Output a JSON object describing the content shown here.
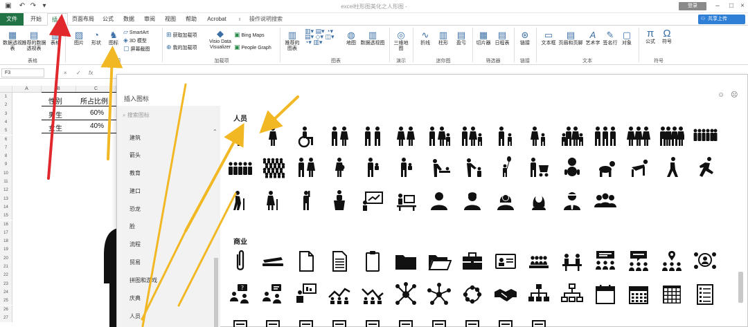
{
  "app": {
    "doc_title": "excel柱形图美化之人形图 -",
    "login_label": "登录",
    "share_label": "共享上传"
  },
  "ribbon": {
    "tabs": [
      {
        "label": "文件",
        "kind": "file"
      },
      {
        "label": "开始",
        "kind": "normal"
      },
      {
        "label": "插入",
        "kind": "active"
      },
      {
        "label": "页面布局",
        "kind": "normal"
      },
      {
        "label": "公式",
        "kind": "normal"
      },
      {
        "label": "数据",
        "kind": "normal"
      },
      {
        "label": "审阅",
        "kind": "normal"
      },
      {
        "label": "视图",
        "kind": "normal"
      },
      {
        "label": "帮助",
        "kind": "normal"
      },
      {
        "label": "Acrobat",
        "kind": "normal"
      },
      {
        "label": "操作说明搜索",
        "kind": "search"
      }
    ],
    "buttons": {
      "pivot": "数据透视表",
      "recommended_pivot": "推荐的数据透视表",
      "table": "表格",
      "picture": "图片",
      "shapes": "形状",
      "icons": "图标",
      "smartart": "SmartArt",
      "model3d": "3D 模型",
      "screenshot": "屏幕截图",
      "get_addins": "获取加载项",
      "my_addins": "我的加载项",
      "visio": "Visio Data Visualizer",
      "bing_maps": "Bing Maps",
      "people_graph": "People Graph",
      "recommended_charts": "推荐的图表",
      "map": "地图",
      "pivot_chart": "数据透视图",
      "map3d": "三维地图",
      "line": "折线",
      "column": "柱形",
      "winloss": "盈亏",
      "slicer": "切片器",
      "timeline": "日程表",
      "link": "链接",
      "textbox": "文本框",
      "header_footer": "页眉和页脚",
      "wordart": "艺术字",
      "signature": "签名行",
      "object": "对象",
      "equation": "公式",
      "symbol": "符号"
    },
    "groups": {
      "tables": "表格",
      "illustrations": "插图",
      "addins": "加载项",
      "charts": "图表",
      "tours": "演示",
      "sparklines": "迷你图",
      "filters": "筛选器",
      "links": "链接",
      "text": "文本",
      "symbols": "符号"
    }
  },
  "formula_bar": {
    "name_box": "F3",
    "fx": "fx"
  },
  "sheet": {
    "columns": [
      "A",
      "B",
      "C"
    ],
    "rows": [
      "1",
      "2",
      "3",
      "4",
      "5",
      "6",
      "7",
      "8",
      "9",
      "10",
      "11",
      "12",
      "13",
      "14",
      "15",
      "16",
      "17",
      "18",
      "19",
      "20",
      "21",
      "22",
      "23",
      "24",
      "25",
      "26",
      "27"
    ],
    "header": {
      "gender": "性别",
      "ratio": "所占比例"
    },
    "data": [
      {
        "gender": "男生",
        "ratio": "60%"
      },
      {
        "gender": "女生",
        "ratio": "40%"
      }
    ]
  },
  "dialog": {
    "title": "插入图标",
    "search_placeholder": "搜索图标",
    "categories": [
      "建筑",
      "箭头",
      "教育",
      "建口",
      "恐龙",
      "脸",
      "流程",
      "贸易",
      "拼图和游戏",
      "庆典",
      "人员"
    ],
    "section_people": "人员",
    "section_business": "商业",
    "people_icons": [
      "man-icon",
      "woman-icon",
      "wheelchair-icon",
      "man-woman-icon",
      "two-men-icon",
      "two-women-icon",
      "couple-child-icon",
      "family-icon",
      "parent-child-icon",
      "woman-child-icon",
      "family-group-icon",
      "three-men-icon",
      "three-women-icon",
      "four-people-icon",
      "crowd-icon",
      "row-people-icon",
      "large-crowd-icon",
      "man-woman-pair-icon",
      "pregnant-icon",
      "carry-child-icon",
      "carry-baby-icon",
      "changing-baby-icon",
      "feeding-child-icon",
      "child-balloon-icon",
      "stroller-icon",
      "baby-icon",
      "crawling-baby-icon",
      "crawling-man-icon",
      "walking-icon",
      "running-icon",
      "elderly-cane-icon",
      "elderly-woman-icon",
      "raised-hand-icon",
      "podium-speaker-icon",
      "presenter-icon",
      "desk-worker-icon",
      "user-avatar-icon",
      "man-avatar-icon",
      "woman-avatar-icon",
      "long-hair-avatar-icon",
      "business-avatar-icon",
      "group-avatar-icon"
    ],
    "business_icons": [
      "paperclip-icon",
      "stapler-icon",
      "document-icon",
      "text-document-icon",
      "clipboard-icon",
      "folder-icon",
      "open-folder-icon",
      "briefcase-icon",
      "id-card-icon",
      "meeting-icon",
      "desk-meeting-icon",
      "presentation-group-icon",
      "speech-group-icon",
      "location-people-icon",
      "network-people-icon",
      "question-people-icon",
      "discussion-icon",
      "presentation-icon",
      "trend-people-icon",
      "downtrend-people-icon",
      "network-node-icon",
      "hub-icon",
      "network-ring-icon",
      "handshake-icon",
      "org-chart-icon",
      "hierarchy-icon",
      "calendar-icon",
      "calendar-grid-icon",
      "spreadsheet-icon",
      "checklist-icon"
    ]
  }
}
